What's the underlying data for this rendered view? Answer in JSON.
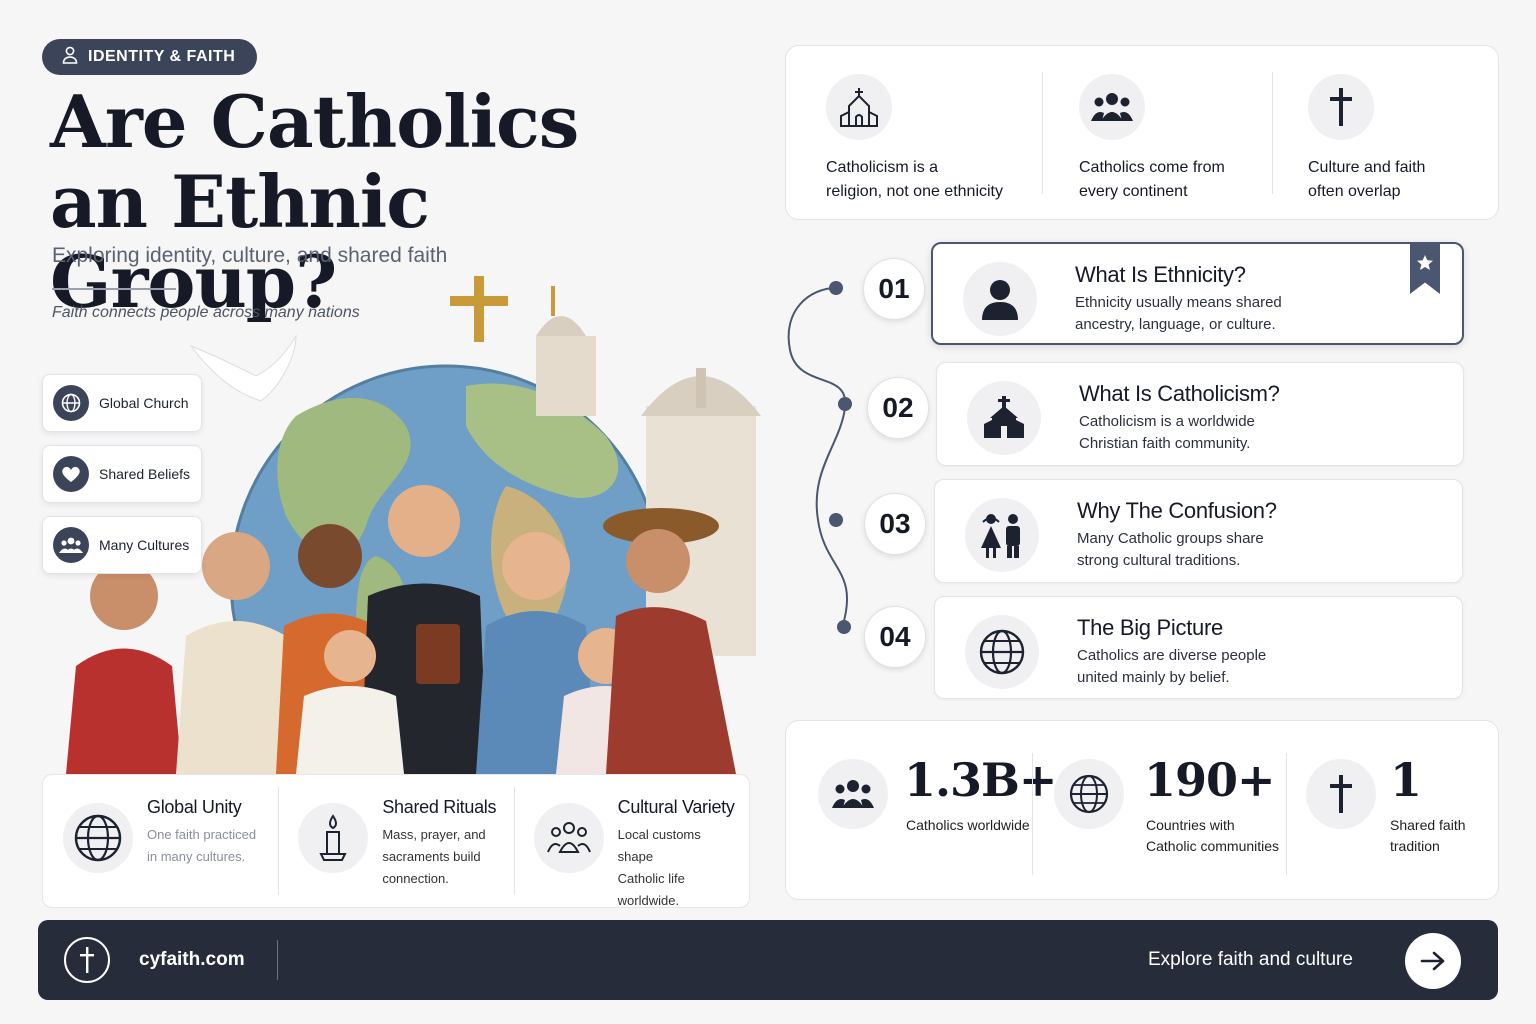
{
  "header": {
    "tag": "IDENTITY & FAITH",
    "title_line1": "Are Catholics",
    "title_line2": "an Ethnic Group?",
    "subtitle": "Exploring identity, culture, and shared faith",
    "tagline": "Faith connects people across many nations"
  },
  "pills": [
    {
      "label": "Global Church",
      "icon": "globe-icon"
    },
    {
      "label": "Shared Beliefs",
      "icon": "heart-icon"
    },
    {
      "label": "Many Cultures",
      "icon": "people-icon"
    }
  ],
  "features": [
    {
      "title": "Global Unity",
      "line1": "One faith practiced",
      "line2": "in many cultures.",
      "line3": "",
      "icon": "globe-icon"
    },
    {
      "title": "Shared Rituals",
      "line1": "Mass, prayer, and",
      "line2": "sacraments build",
      "line3": "connection.",
      "icon": "candle-icon"
    },
    {
      "title": "Cultural Variety",
      "line1": "Local customs shape",
      "line2": "Catholic life",
      "line3": "worldwide.",
      "icon": "people-icon"
    }
  ],
  "facts": [
    {
      "line1": "Catholicism is a",
      "line2": "religion, not one ethnicity",
      "icon": "church-icon"
    },
    {
      "line1": "Catholics come from",
      "line2": "every continent",
      "icon": "people-icon"
    },
    {
      "line1": "Culture and faith",
      "line2": "often overlap",
      "icon": "cross-icon"
    }
  ],
  "steps": [
    {
      "num": "01",
      "title": "What Is Ethnicity?",
      "line1": "Ethnicity usually means shared",
      "line2": "ancestry, language, or culture.",
      "icon": "person-icon"
    },
    {
      "num": "02",
      "title": "What Is Catholicism?",
      "line1": "Catholicism is a worldwide",
      "line2": "Christian faith community.",
      "icon": "church-icon"
    },
    {
      "num": "03",
      "title": "Why The Confusion?",
      "line1": "Many Catholic groups share",
      "line2": "strong cultural traditions.",
      "icon": "couple-icon"
    },
    {
      "num": "04",
      "title": "The Big Picture",
      "line1": "Catholics are diverse people",
      "line2": "united mainly by belief.",
      "icon": "globe-icon"
    }
  ],
  "stats": [
    {
      "value": "1.3B+",
      "line1": "Catholics worldwide",
      "line2": "",
      "icon": "people-icon"
    },
    {
      "value": "190+",
      "line1": "Countries with",
      "line2": "Catholic communities",
      "icon": "globe-icon"
    },
    {
      "value": "1",
      "line1": "Shared faith",
      "line2": "tradition",
      "icon": "cross-icon"
    }
  ],
  "footer": {
    "site": "cyfaith.com",
    "cta": "Explore faith and culture"
  },
  "colors": {
    "navy": "#262c3a",
    "slate": "#3b4459",
    "accent": "#4b5670"
  }
}
